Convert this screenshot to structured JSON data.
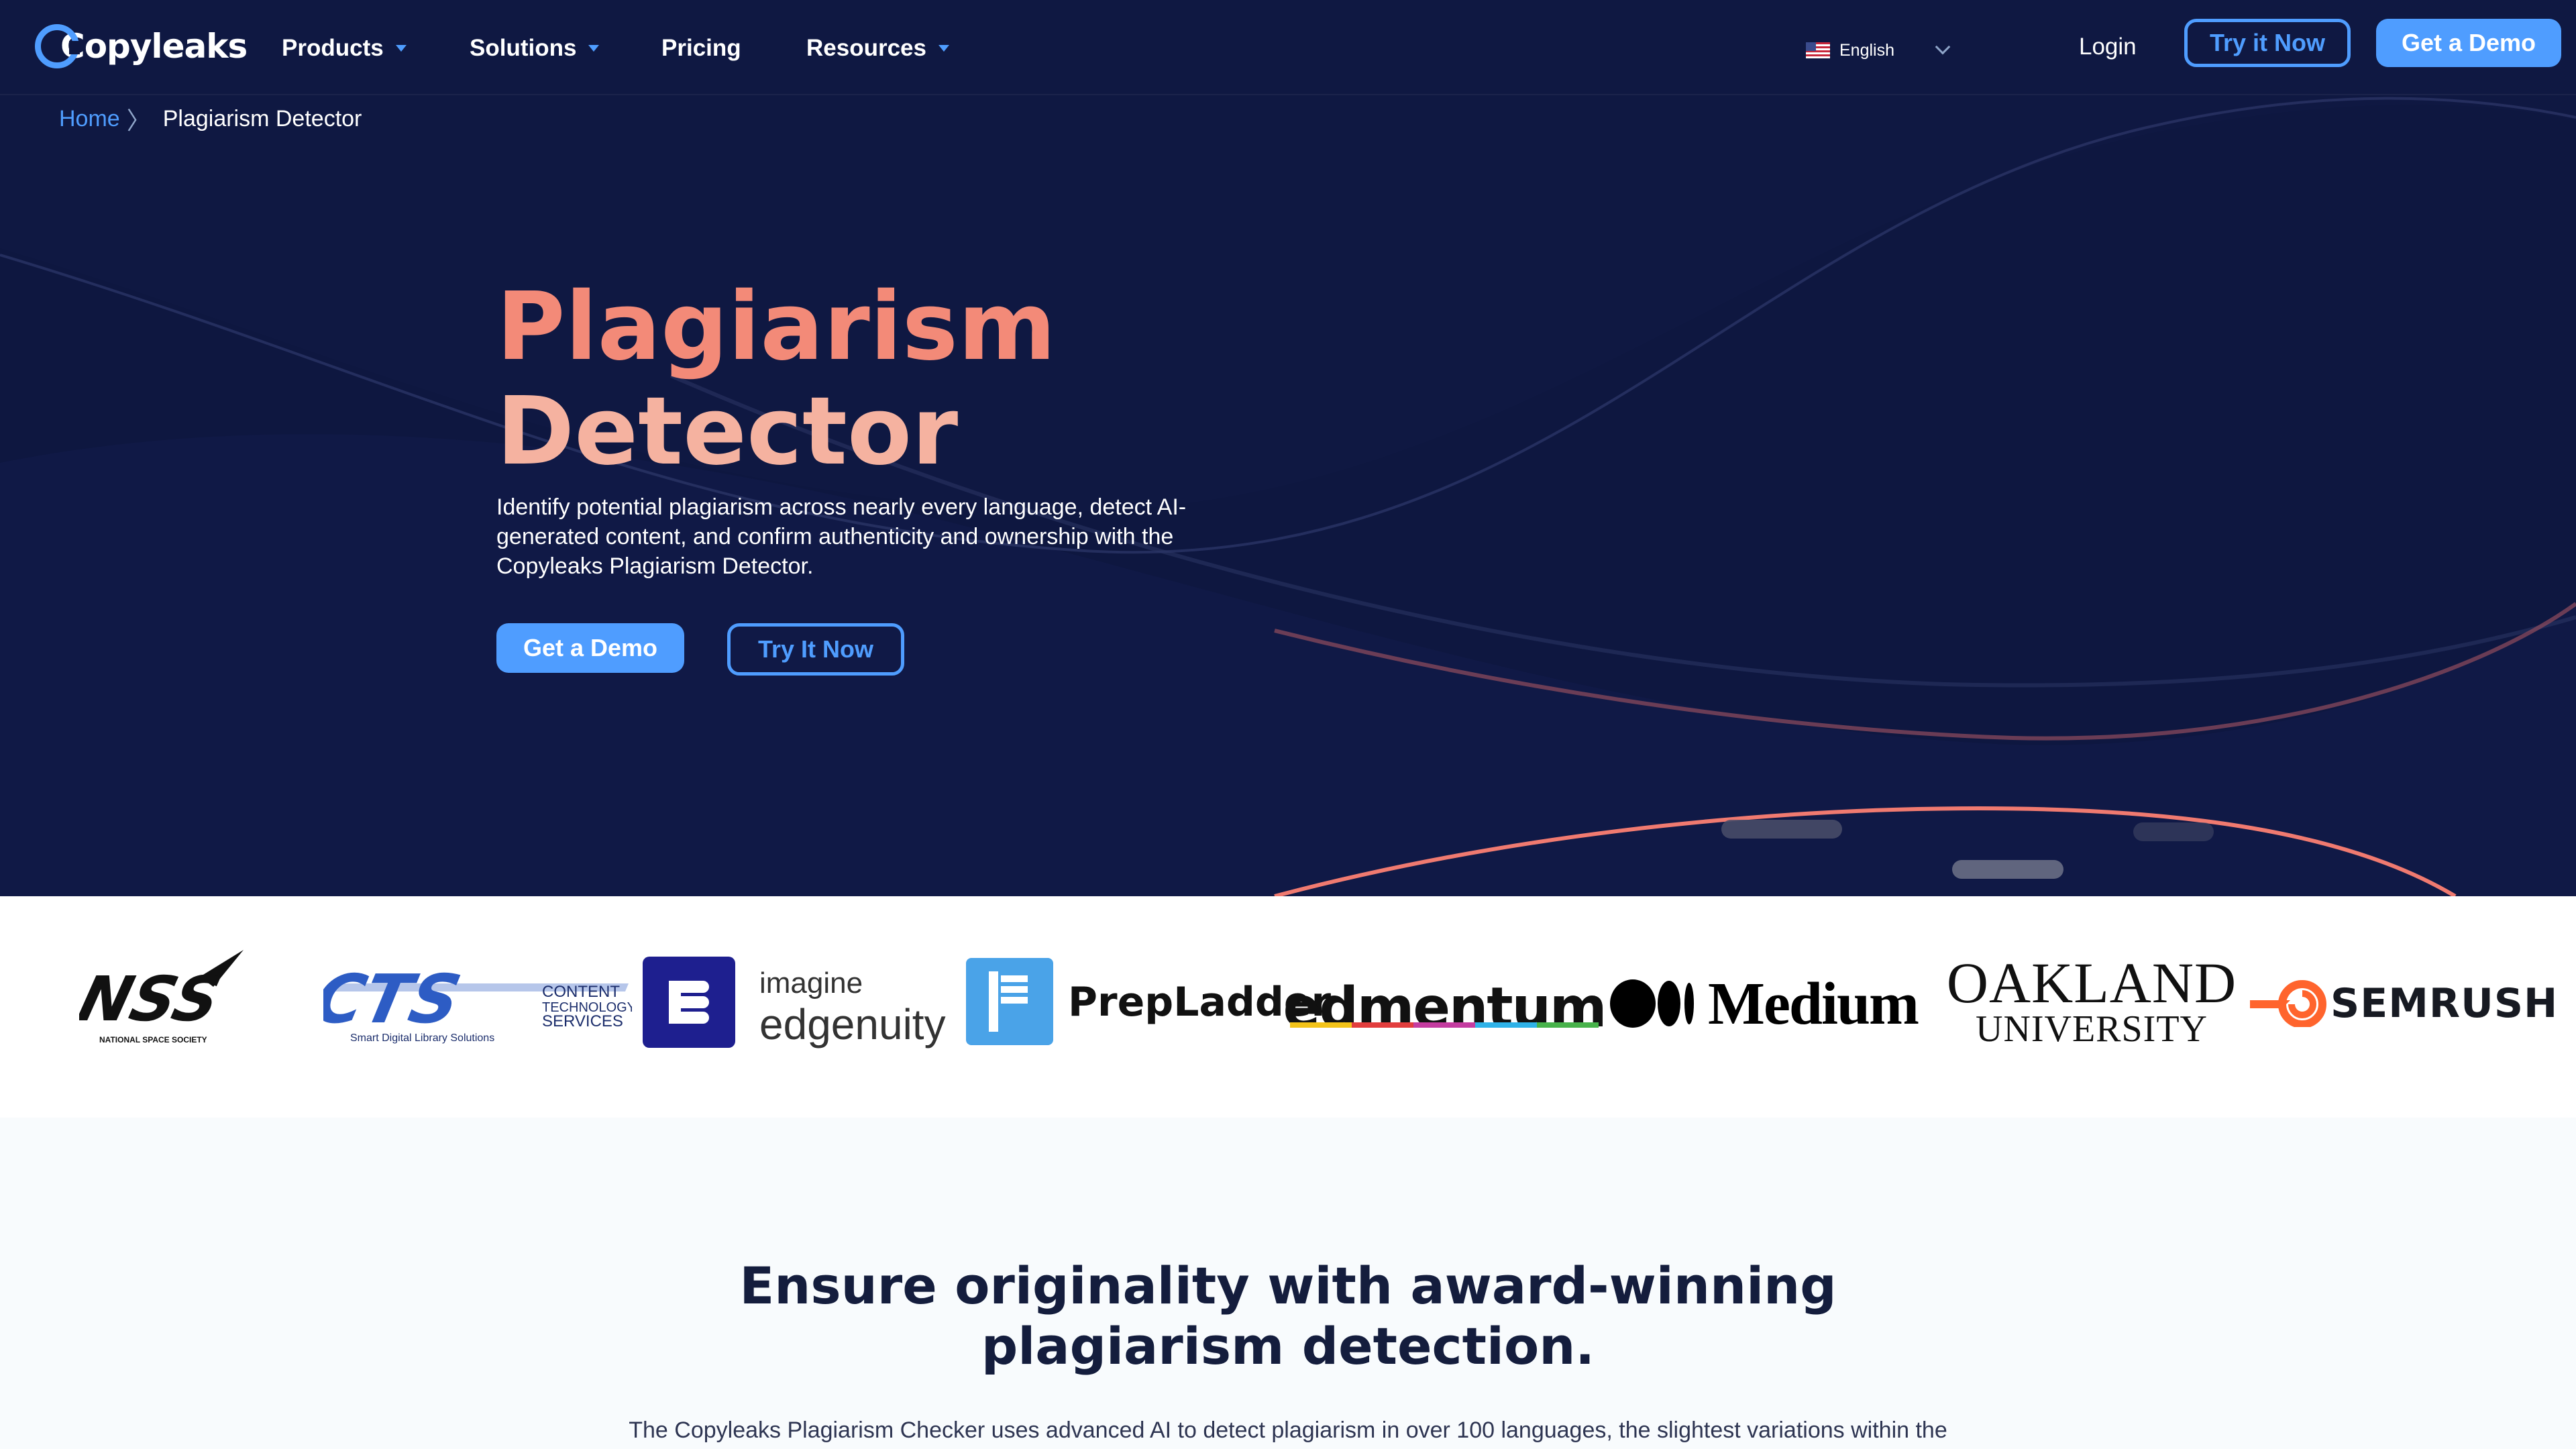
{
  "nav": {
    "logo_text": "Copyleaks",
    "items": [
      {
        "label": "Products",
        "has_dropdown": true
      },
      {
        "label": "Solutions",
        "has_dropdown": true
      },
      {
        "label": "Pricing",
        "has_dropdown": false
      },
      {
        "label": "Resources",
        "has_dropdown": true
      }
    ],
    "language": "English",
    "login": "Login",
    "try_it_now": "Try it Now",
    "get_a_demo": "Get a Demo"
  },
  "breadcrumb": {
    "home": "Home",
    "separator": "〉",
    "current": "Plagiarism Detector"
  },
  "hero": {
    "title_line1": "Plagiarism",
    "title_line2": "Detector",
    "description": "Identify potential plagiarism across nearly every language, detect AI-generated content, and confirm authenticity and ownership with the Copyleaks Plagiarism Detector.",
    "cta_demo": "Get a Demo",
    "cta_try": "Try It Now"
  },
  "client_logos": {
    "nss": {
      "mark": "NSS",
      "caption": "NATIONAL SPACE SOCIETY"
    },
    "cts": {
      "mark": "CTS",
      "line1": "CONTENT",
      "line2": "TECHNOLOGY",
      "line3": "SERVICES",
      "caption": "Smart Digital Library Solutions"
    },
    "edgenuity": {
      "line1": "imagine",
      "line2": "edgenuity"
    },
    "prepladder": "PrepLadder",
    "edmentum": "edmentum",
    "medium": "Medium",
    "oakland": {
      "line1": "OAKLAND",
      "line2": "UNIVERSITY"
    },
    "semrush": "SEMRUSH"
  },
  "section": {
    "title_line1": "Ensure originality with award-winning",
    "title_line2": "plagiarism detection.",
    "body": "The Copyleaks Plagiarism Checker uses advanced AI to detect plagiarism in over 100 languages, the slightest variations within the"
  },
  "colors": {
    "hero_bg": "#0e1740",
    "accent_blue": "#4f9dff",
    "title_coral": "#f38a78",
    "title_peach": "#f5b2a0",
    "section_title": "#141d3d"
  }
}
